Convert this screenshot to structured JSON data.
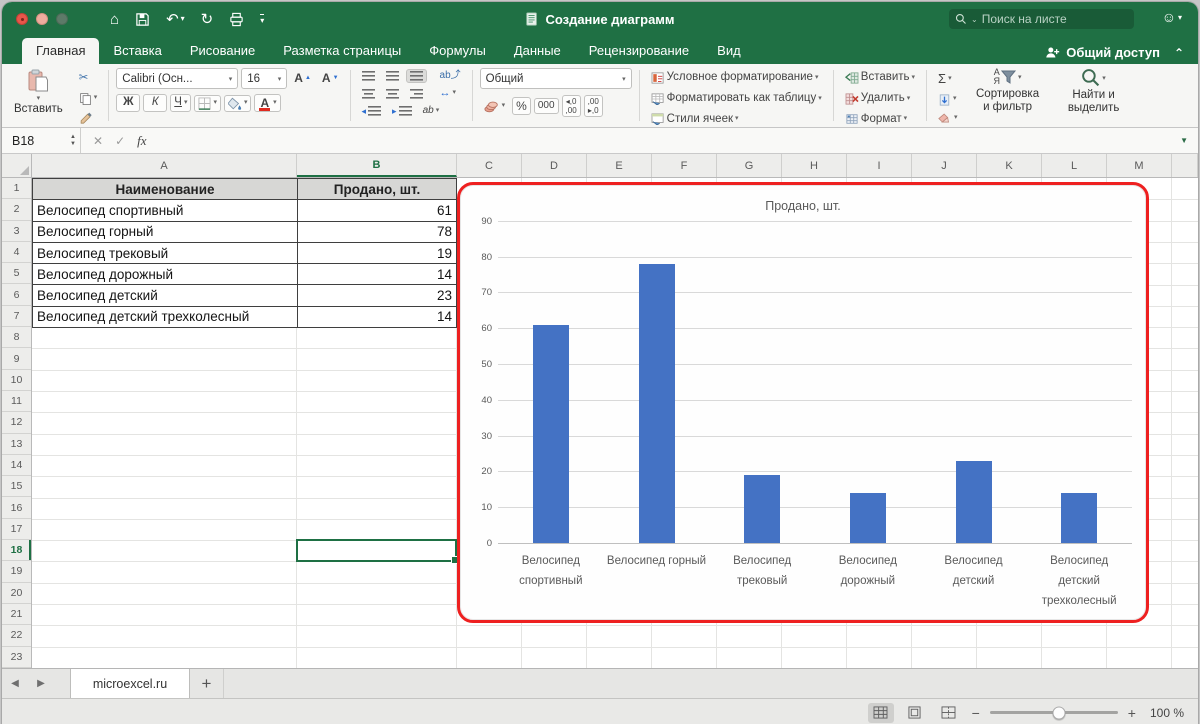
{
  "window": {
    "title": "Создание диаграмм"
  },
  "icons": {
    "home": "⌂",
    "undo": "↶",
    "redo": "↻",
    "qa_more": "▾",
    "smiley": "☺",
    "caret": "▾",
    "chevron_up": "⌃",
    "search_caret": "⌄",
    "scissors": "✂",
    "up_tri": "▲",
    "down_tri": "▼",
    "indent_left": "◂",
    "indent_right": "▸",
    "wrap": "ab",
    "orient": "ab⤴",
    "merge": "↔",
    "cancel": "✕",
    "enter": "✓",
    "fx": "fx",
    "tab_prev": "◀",
    "tab_next": "▶",
    "add_sheet": "+",
    "minus": "−",
    "plus": "+",
    "sigma": "Σ",
    "sort_az": "А я"
  },
  "search": {
    "placeholder": "Поиск на листе"
  },
  "tabs": [
    {
      "label": "Главная",
      "active": true
    },
    {
      "label": "Вставка"
    },
    {
      "label": "Рисование"
    },
    {
      "label": "Разметка страницы"
    },
    {
      "label": "Формулы"
    },
    {
      "label": "Данные"
    },
    {
      "label": "Рецензирование"
    },
    {
      "label": "Вид"
    }
  ],
  "share": {
    "label": "Общий доступ"
  },
  "ribbon": {
    "clipboard": {
      "paste": "Вставить"
    },
    "font": {
      "name": "Calibri (Осн...",
      "size": "16",
      "bold": "Ж",
      "italic": "К",
      "underline": "Ч",
      "grow": "A",
      "shrink": "A",
      "color": "A"
    },
    "number": {
      "format": "Общий",
      "percent": "%",
      "thousands": "000",
      "inc_decimal": "◂,0\n,00",
      "dec_decimal": ",00\n▸,0"
    },
    "styles": {
      "conditional": "Условное форматирование",
      "format_table": "Форматировать как таблицу",
      "cell_styles": "Стили ячеек"
    },
    "cells": {
      "insert": "Вставить",
      "delete": "Удалить",
      "format": "Формат"
    },
    "editing": {
      "sort": "Сортировка и фильтр",
      "find": "Найти и выделить"
    }
  },
  "formula_bar": {
    "name_box": "B18"
  },
  "grid": {
    "columns": [
      "A",
      "B",
      "C",
      "D",
      "E",
      "F",
      "G",
      "H",
      "I",
      "J",
      "K",
      "L",
      "M"
    ],
    "selected_column": "B",
    "selected_row": 18,
    "visible_rows": 23
  },
  "table": {
    "headers": [
      "Наименование",
      "Продано, шт."
    ],
    "rows": [
      [
        "Велосипед спортивный",
        61
      ],
      [
        "Велосипед горный",
        78
      ],
      [
        "Велосипед трековый",
        19
      ],
      [
        "Велосипед дорожный",
        14
      ],
      [
        "Велосипед детский",
        23
      ],
      [
        "Велосипед детский трехколесный",
        14
      ]
    ]
  },
  "chart_data": {
    "type": "bar",
    "title": "Продано, шт.",
    "categories": [
      "Велосипед спортивный",
      "Велосипед горный",
      "Велосипед трековый",
      "Велосипед дорожный",
      "Велосипед детский",
      "Велосипед детский трехколесный"
    ],
    "values": [
      61,
      78,
      19,
      14,
      23,
      14
    ],
    "tick_labels": [
      "Велосипед\nспортивный",
      "Велосипед горный",
      "Велосипед\nтрековый",
      "Велосипед\nдорожный",
      "Велосипед\nдетский",
      "Велосипед\nдетский\nтрехколесный"
    ],
    "xlabel": "",
    "ylabel": "",
    "ylim": [
      0,
      90
    ],
    "ytick_step": 10,
    "grid": true,
    "legend": false,
    "bar_color": "#4472C4"
  },
  "sheet_bar": {
    "active_tab": "microexcel.ru"
  },
  "status_bar": {
    "zoom": "100 %"
  }
}
